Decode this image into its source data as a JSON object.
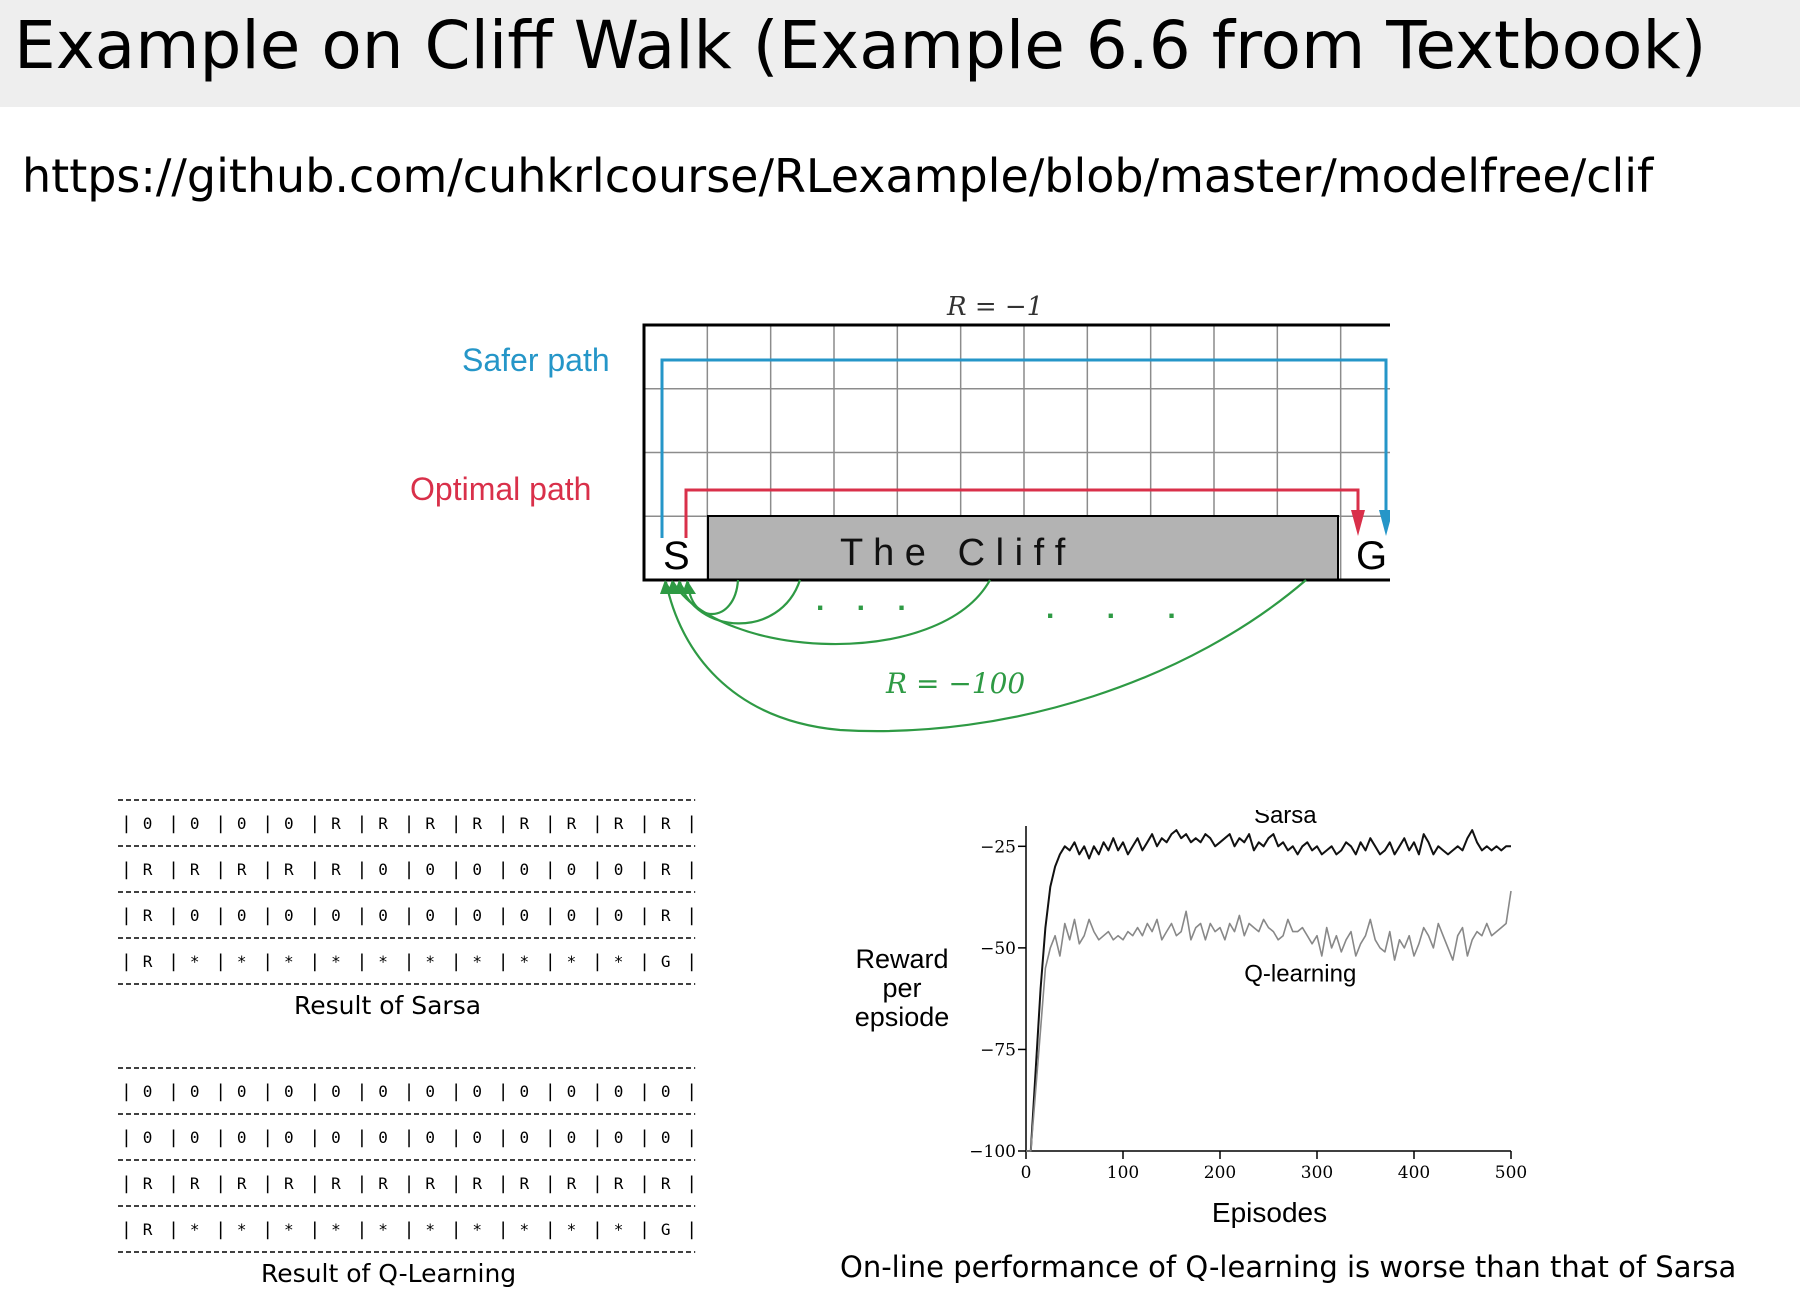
{
  "slide": {
    "title": "Example on Cliff Walk (Example 6.6 from Textbook)",
    "url": "https://github.com/cuhkrlcourse/RLexample/blob/master/modelfree/clif"
  },
  "colors": {
    "safer": "#2596c8",
    "optimal": "#d9304a",
    "cliff_return": "#2e9a44",
    "cliff_fill": "#b3b3b3"
  },
  "diagram": {
    "step_reward_label": "R = −1",
    "safer_path_label": "Safer path",
    "optimal_path_label": "Optimal path",
    "start_label": "S",
    "goal_label": "G",
    "cliff_label": "T h e   C l i f f",
    "cliff_reward_label": "R = −100",
    "ellipsis": ". . ."
  },
  "tables": {
    "sarsa": {
      "rows": [
        [
          "0",
          "0",
          "0",
          "0",
          "R",
          "R",
          "R",
          "R",
          "R",
          "R",
          "R",
          "R"
        ],
        [
          "R",
          "R",
          "R",
          "R",
          "R",
          "0",
          "0",
          "0",
          "0",
          "0",
          "0",
          "R"
        ],
        [
          "R",
          "0",
          "0",
          "0",
          "0",
          "0",
          "0",
          "0",
          "0",
          "0",
          "0",
          "R"
        ],
        [
          "R",
          "*",
          "*",
          "*",
          "*",
          "*",
          "*",
          "*",
          "*",
          "*",
          "*",
          "G"
        ]
      ],
      "caption": "Result of Sarsa"
    },
    "qlearning": {
      "rows": [
        [
          "0",
          "0",
          "0",
          "0",
          "0",
          "0",
          "0",
          "0",
          "0",
          "0",
          "0",
          "0"
        ],
        [
          "0",
          "0",
          "0",
          "0",
          "0",
          "0",
          "0",
          "0",
          "0",
          "0",
          "0",
          "0"
        ],
        [
          "R",
          "R",
          "R",
          "R",
          "R",
          "R",
          "R",
          "R",
          "R",
          "R",
          "R",
          "R"
        ],
        [
          "R",
          "*",
          "*",
          "*",
          "*",
          "*",
          "*",
          "*",
          "*",
          "*",
          "*",
          "G"
        ]
      ],
      "caption": "Result of Q-Learning"
    }
  },
  "chart_data": {
    "type": "line",
    "xlabel": "Episodes",
    "ylabel": [
      "Reward",
      "per",
      "epsiode"
    ],
    "xlim": [
      0,
      500
    ],
    "ylim": [
      -100,
      -20
    ],
    "xticks": [
      0,
      100,
      200,
      300,
      400,
      500
    ],
    "yticks": [
      -25,
      -50,
      -75,
      -100
    ],
    "series": [
      {
        "name": "Sarsa",
        "color": "#111111",
        "x": [
          0,
          5,
          10,
          15,
          20,
          25,
          30,
          35,
          40,
          45,
          50,
          55,
          60,
          65,
          70,
          75,
          80,
          85,
          90,
          95,
          100,
          105,
          110,
          115,
          120,
          125,
          130,
          135,
          140,
          145,
          150,
          155,
          160,
          165,
          170,
          175,
          180,
          185,
          190,
          195,
          200,
          205,
          210,
          215,
          220,
          225,
          230,
          235,
          240,
          245,
          250,
          255,
          260,
          265,
          270,
          275,
          280,
          285,
          290,
          295,
          300,
          305,
          310,
          315,
          320,
          325,
          330,
          335,
          340,
          345,
          350,
          355,
          360,
          365,
          370,
          375,
          380,
          385,
          390,
          395,
          400,
          405,
          410,
          415,
          420,
          425,
          430,
          435,
          440,
          445,
          450,
          455,
          460,
          465,
          470,
          475,
          480,
          485,
          490,
          495,
          500
        ],
        "values": [
          -100,
          -100,
          -80,
          -60,
          -45,
          -35,
          -30,
          -27,
          -25,
          -26,
          -24,
          -27,
          -25,
          -28,
          -25,
          -27,
          -24,
          -26,
          -23,
          -26,
          -24,
          -27,
          -25,
          -23,
          -26,
          -24,
          -22,
          -25,
          -23,
          -24,
          -22,
          -21,
          -23,
          -22,
          -24,
          -23,
          -24,
          -22,
          -23,
          -25,
          -24,
          -23,
          -22,
          -25,
          -23,
          -24,
          -22,
          -26,
          -24,
          -25,
          -23,
          -22,
          -25,
          -24,
          -26,
          -25,
          -27,
          -25,
          -24,
          -26,
          -25,
          -27,
          -26,
          -25,
          -27,
          -26,
          -24,
          -25,
          -27,
          -24,
          -26,
          -23,
          -25,
          -27,
          -26,
          -24,
          -27,
          -25,
          -23,
          -26,
          -24,
          -27,
          -22,
          -24,
          -27,
          -25,
          -26,
          -27,
          -26,
          -25,
          -26,
          -23,
          -21,
          -24,
          -26,
          -25,
          -26,
          -25,
          -26,
          -25,
          -25
        ]
      },
      {
        "name": "Q-learning",
        "color": "#888888",
        "x": [
          0,
          5,
          10,
          15,
          20,
          25,
          30,
          35,
          40,
          45,
          50,
          55,
          60,
          65,
          70,
          75,
          80,
          85,
          90,
          95,
          100,
          105,
          110,
          115,
          120,
          125,
          130,
          135,
          140,
          145,
          150,
          155,
          160,
          165,
          170,
          175,
          180,
          185,
          190,
          195,
          200,
          205,
          210,
          215,
          220,
          225,
          230,
          235,
          240,
          245,
          250,
          255,
          260,
          265,
          270,
          275,
          280,
          285,
          290,
          295,
          300,
          305,
          310,
          315,
          320,
          325,
          330,
          335,
          340,
          345,
          350,
          355,
          360,
          365,
          370,
          375,
          380,
          385,
          390,
          395,
          400,
          405,
          410,
          415,
          420,
          425,
          430,
          435,
          440,
          445,
          450,
          455,
          460,
          465,
          470,
          475,
          480,
          485,
          490,
          495,
          500
        ],
        "values": [
          -100,
          -100,
          -85,
          -70,
          -55,
          -50,
          -47,
          -52,
          -44,
          -48,
          -43,
          -49,
          -47,
          -43,
          -46,
          -48,
          -47,
          -46,
          -48,
          -47,
          -48,
          -46,
          -47,
          -45,
          -47,
          -44,
          -46,
          -43,
          -48,
          -46,
          -44,
          -47,
          -46,
          -41,
          -48,
          -45,
          -44,
          -48,
          -44,
          -46,
          -45,
          -48,
          -44,
          -46,
          -42,
          -47,
          -44,
          -45,
          -46,
          -43,
          -45,
          -46,
          -48,
          -47,
          -43,
          -46,
          -46,
          -45,
          -47,
          -49,
          -47,
          -52,
          -45,
          -50,
          -47,
          -51,
          -48,
          -46,
          -52,
          -49,
          -47,
          -43,
          -48,
          -50,
          -51,
          -46,
          -53,
          -48,
          -50,
          -47,
          -52,
          -49,
          -45,
          -47,
          -50,
          -44,
          -47,
          -50,
          -53,
          -47,
          -45,
          -52,
          -48,
          -46,
          -47,
          -44,
          -47,
          -46,
          -45,
          -44,
          -36
        ]
      }
    ],
    "annotations": [
      {
        "text": "Sarsa",
        "x": 235,
        "y": -17
      },
      {
        "text": "Q-learning",
        "x": 225,
        "y": -56
      }
    ]
  },
  "chart_caption": "On-line performance of Q-learning is worse than that of Sarsa"
}
